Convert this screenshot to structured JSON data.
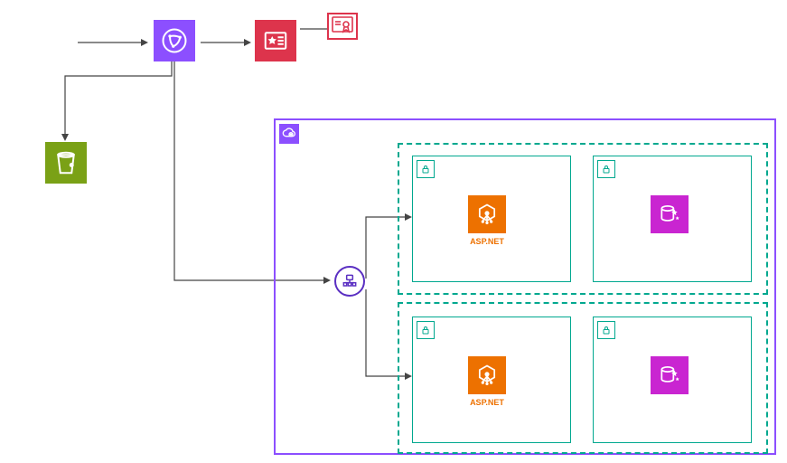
{
  "nodes": {
    "cloudfront": {
      "label": ""
    },
    "waf": {
      "label": ""
    },
    "acm": {
      "label": ""
    },
    "s3": {
      "label": ""
    },
    "alb": {
      "label": ""
    },
    "asg1_compute": {
      "label": "ASP.NET"
    },
    "asg2_compute": {
      "label": "ASP.NET"
    },
    "db1": {
      "label": ""
    },
    "db2": {
      "label": ""
    }
  },
  "region": {
    "badge": "cloud"
  },
  "subnets": {
    "a1": {
      "badge": "lock"
    },
    "a2": {
      "badge": "lock"
    },
    "b1": {
      "badge": "lock"
    },
    "b2": {
      "badge": "lock"
    }
  },
  "colors": {
    "purple": "#8c4fff",
    "crimson": "#dd344c",
    "olive": "#7aa116",
    "orange": "#ed7100",
    "magenta": "#c925d1",
    "teal": "#00a88f",
    "indigo": "#5a2fc2"
  }
}
